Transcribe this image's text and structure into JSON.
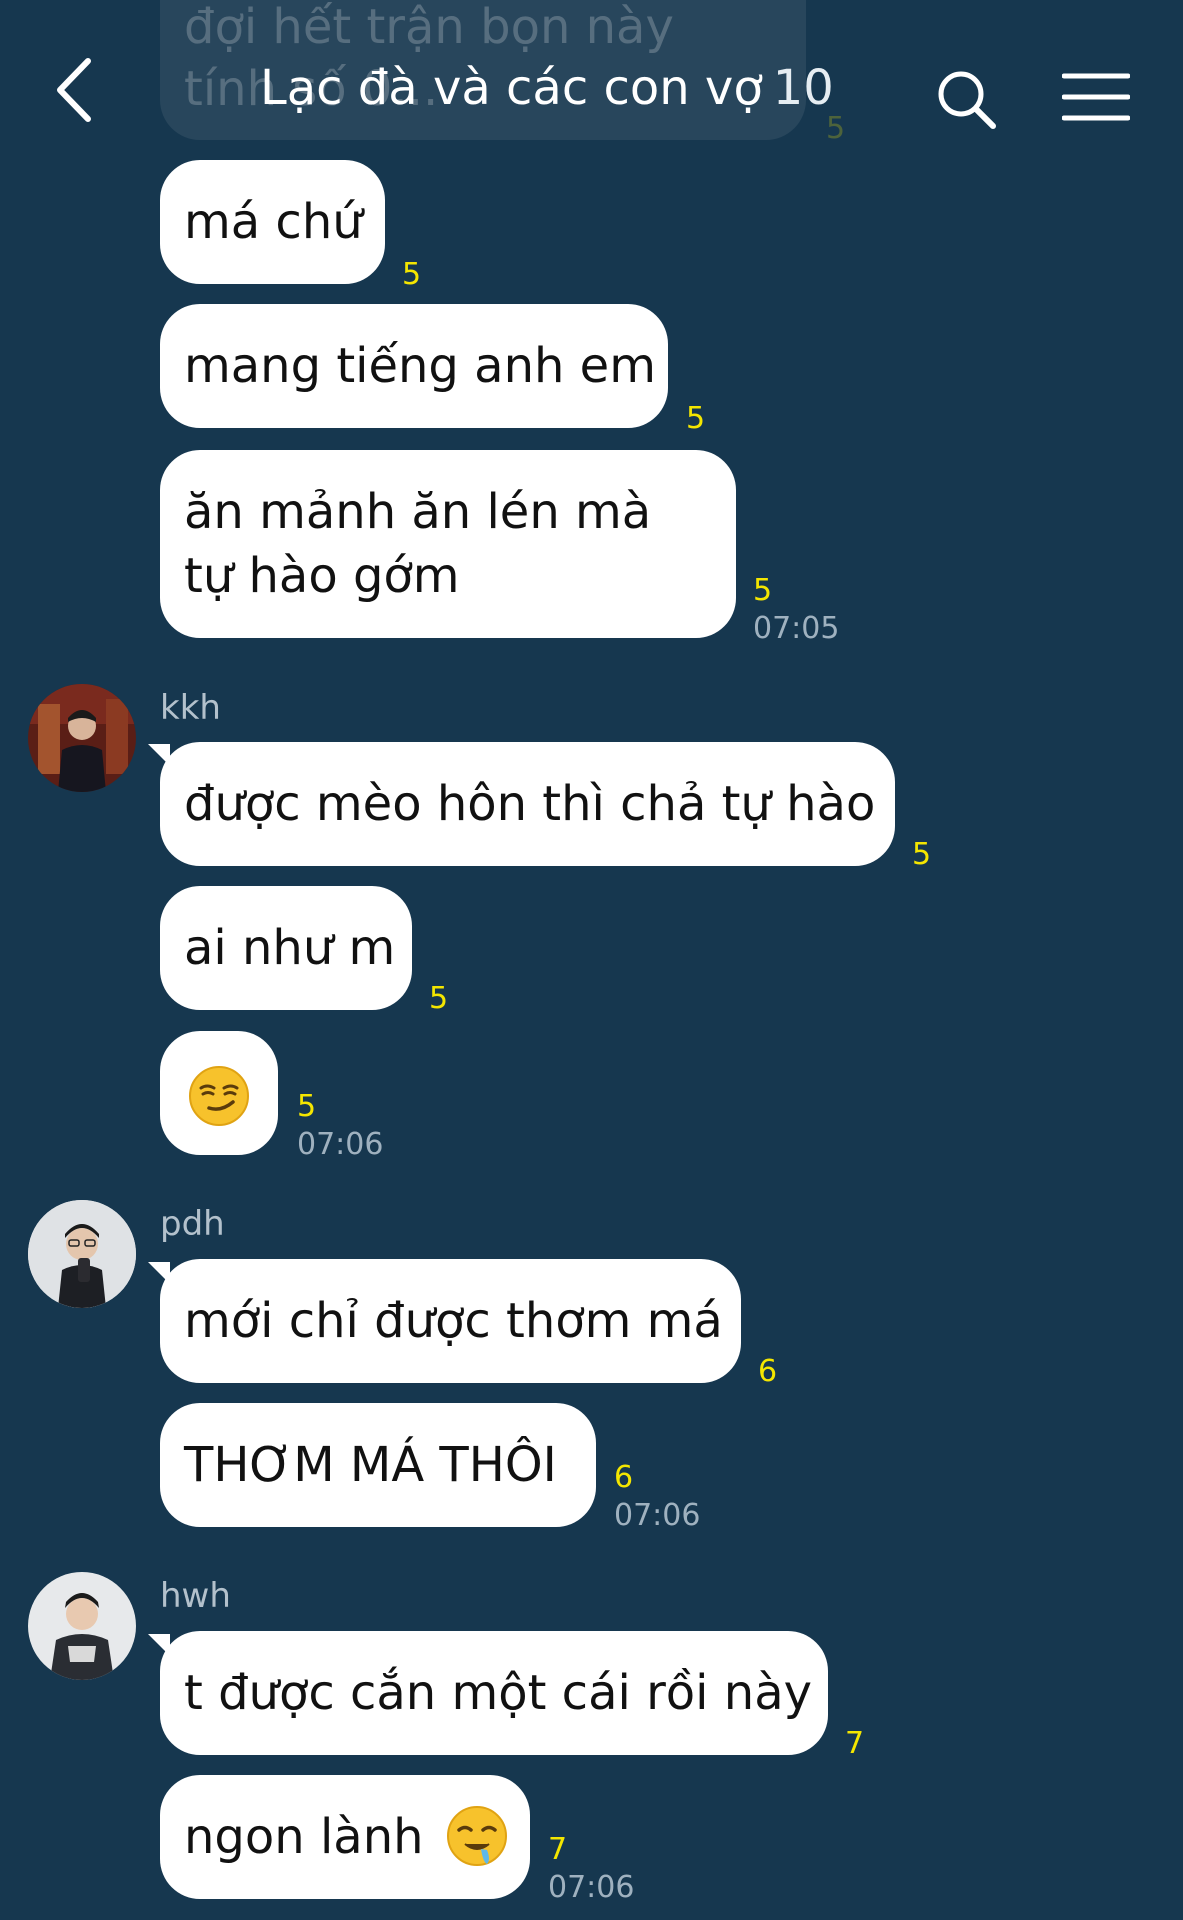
{
  "header": {
    "title": "Lạc đà và các con vợ",
    "member_count": "10"
  },
  "messages": {
    "ghost": {
      "text": "đợi hết trận bọn này tính số 0...",
      "read": "5"
    },
    "m1": {
      "text": "má chứ",
      "read": "5"
    },
    "m2": {
      "text": "mang tiếng anh em",
      "read": "5"
    },
    "m3": {
      "text": "ăn mảnh ăn lén mà tự hào gớm",
      "read": "5",
      "time": "07:05"
    },
    "kkh": {
      "sender": "kkh",
      "m1": {
        "text": "được mèo hôn thì chả tự hào",
        "read": "5"
      },
      "m2": {
        "text": "ai như m",
        "read": "5"
      },
      "m3": {
        "emoji": "smirk",
        "read": "5",
        "time": "07:06"
      }
    },
    "pdh": {
      "sender": "pdh",
      "m1": {
        "text": "mới chỉ được thơm má",
        "read": "6"
      },
      "m2": {
        "text": "THƠM MÁ THÔI",
        "read": "6",
        "time": "07:06"
      }
    },
    "hwh": {
      "sender": "hwh",
      "m1": {
        "text": "t được cắn một cái rồi này",
        "read": "7"
      },
      "m2": {
        "text": "ngon lành",
        "emoji": "drooling",
        "read": "7",
        "time": "07:06"
      }
    }
  },
  "colors": {
    "background": "#16374f",
    "bubble": "#ffffff",
    "read_count": "#f4e600",
    "timestamp": "#9fb1bf"
  }
}
